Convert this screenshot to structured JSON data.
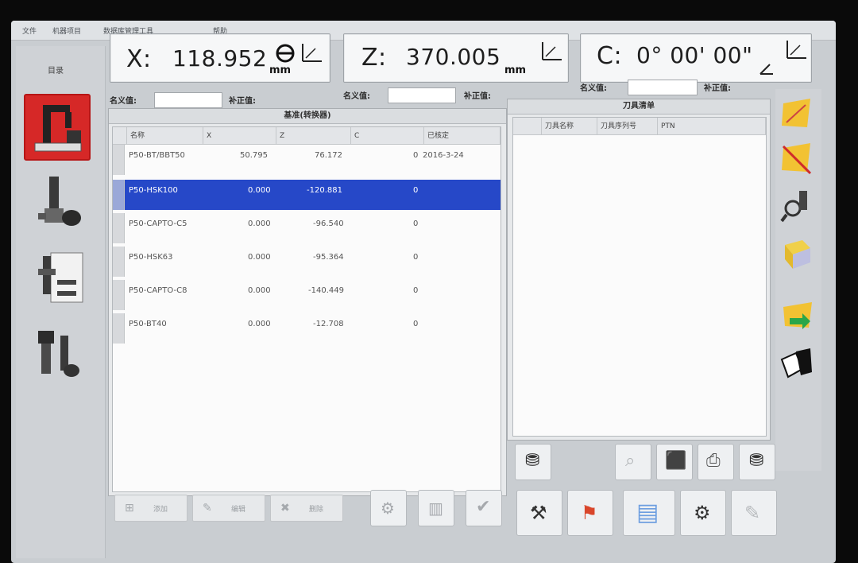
{
  "menu": [
    "文件",
    "机器项目",
    "数据库管理工具",
    "帮助"
  ],
  "left_title": "目录",
  "left_tools": [
    "machine-icon",
    "tool-holder-icon",
    "document-tool-icon",
    "spindle-tools-icon"
  ],
  "coords": {
    "x": {
      "label": "X:",
      "value": "118.952",
      "unit": "mm"
    },
    "z": {
      "label": "Z:",
      "value": "370.005",
      "unit": "mm"
    },
    "c": {
      "label": "C:",
      "value": "0° 00' 00\""
    }
  },
  "fields": {
    "name_label": "名义值:",
    "offset_label": "补正值:"
  },
  "left_table": {
    "title": "基准(转换器)",
    "columns": [
      "名称",
      "X",
      "Z",
      "C",
      "已核定"
    ],
    "rows": [
      {
        "name": "P50-BT/BBT50",
        "x": "50.795",
        "z": "76.172",
        "c": "0",
        "date": "2016-3-24"
      },
      {
        "name": "P50-HSK100",
        "x": "0.000",
        "z": "-120.881",
        "c": "0",
        "date": ""
      },
      {
        "name": "P50-CAPTO-C5",
        "x": "0.000",
        "z": "-96.540",
        "c": "0",
        "date": ""
      },
      {
        "name": "P50-HSK63",
        "x": "0.000",
        "z": "-95.364",
        "c": "0",
        "date": ""
      },
      {
        "name": "P50-CAPTO-C8",
        "x": "0.000",
        "z": "-140.449",
        "c": "0",
        "date": ""
      },
      {
        "name": "P50-BT40",
        "x": "0.000",
        "z": "-12.708",
        "c": "0",
        "date": ""
      }
    ]
  },
  "right_table": {
    "title": "刀具清单",
    "columns": [
      "刀具名称",
      "刀具序列号",
      "PTN"
    ]
  },
  "bottom_buttons": {
    "add": "添加",
    "edit": "编辑",
    "delete": "删除"
  },
  "colors": {
    "accent_red": "#d62827",
    "selected_blue": "#2648c8"
  }
}
